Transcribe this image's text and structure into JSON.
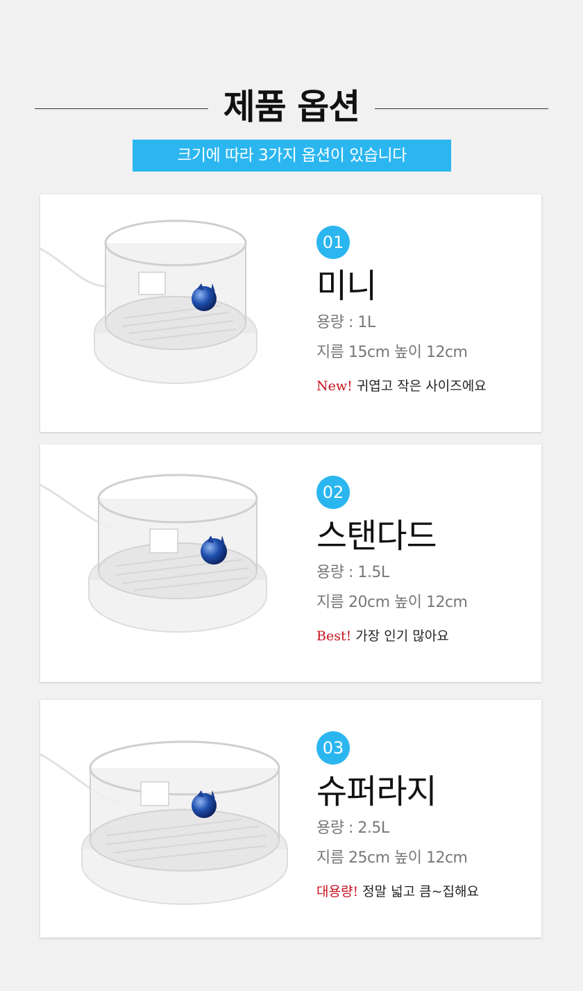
{
  "header": {
    "title": "제품 옵션",
    "subtitle": "크기에 따라 3가지 옵션이 있습니다"
  },
  "colors": {
    "accent": "#2bb6f0",
    "highlight": "#c8101b",
    "background": "#f1f1f1"
  },
  "options": [
    {
      "number": "01",
      "name": "미니",
      "capacity": "용량 : 1L",
      "size": "지름 15cm 높이 12cm",
      "tag": "New!",
      "note": " 귀엽고 작은 사이즈에요"
    },
    {
      "number": "02",
      "name": "스탠다드",
      "capacity": "용량 : 1.5L",
      "size": "지름 20cm 높이 12cm",
      "tag": "Best!",
      "note": " 가장 인기 많아요"
    },
    {
      "number": "03",
      "name": "슈퍼라지",
      "capacity": "용량 : 2.5L",
      "size": "지름 25cm 높이 12cm",
      "tag": "대용량!",
      "note": " 정말 넓고 큼~집해요"
    }
  ]
}
